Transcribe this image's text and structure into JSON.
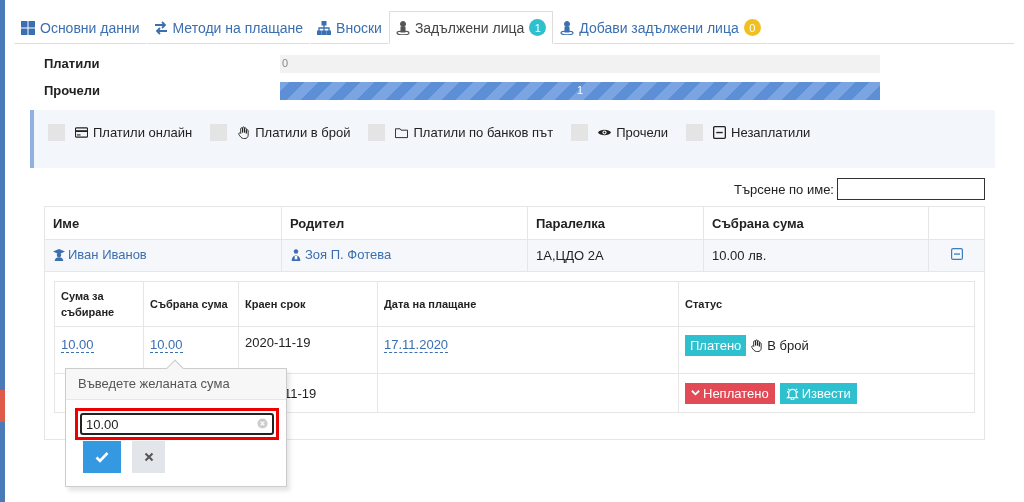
{
  "tabs": [
    {
      "label": "Основни данни",
      "selected": false
    },
    {
      "label": "Методи на плащане",
      "selected": false
    },
    {
      "label": "Вноски",
      "selected": false
    },
    {
      "label": "Задължени лица",
      "selected": true,
      "badge": "1",
      "color": "#2fc0cf"
    },
    {
      "label": "Добави задължени лица",
      "selected": false,
      "badge": "0",
      "color": "#f0c020"
    }
  ],
  "progress": [
    {
      "label": "Платили",
      "level": 0,
      "value": "0"
    },
    {
      "label": "Прочели",
      "level": 1,
      "value": "1"
    }
  ],
  "filters": [
    {
      "label": "Платили онлайн",
      "checked": false
    },
    {
      "label": "Платили в брой",
      "checked": false
    },
    {
      "label": "Платили по банков път",
      "checked": false
    },
    {
      "label": "Прочели",
      "checked": false
    },
    {
      "label": "Незаплатили",
      "checked": false
    }
  ],
  "search": {
    "label": "Търсене по име:"
  },
  "table": {
    "columns": [
      "Име",
      "Родител",
      "Паралелка",
      "Събрана сума"
    ],
    "rows": [
      {
        "name": "Иван Иванов",
        "parent": "Зоя П. Фотева",
        "class": "1А,ЦДО 2А",
        "collected": "10.00 лв.",
        "expanded": true,
        "payments": {
          "columns": [
            "Сума за събиране",
            "Събрана сума",
            "Краен срок",
            "Дата на плащане",
            "Статус"
          ],
          "rows": [
            {
              "amount": "10.00",
              "collected": "10.00",
              "deadline": "2020-11-19",
              "paid_date": "17.11.2020",
              "status": {
                "kind": "paid",
                "label": "Платено",
                "method": "В брой"
              }
            },
            {
              "deadline": "11-19",
              "status": {
                "kind": "unpaid",
                "label": "Неплатено",
                "action": "Извести"
              }
            }
          ]
        }
      }
    ]
  },
  "popover": {
    "title": "Въведете желаната сума",
    "value": "10.00",
    "highlighted": true
  }
}
